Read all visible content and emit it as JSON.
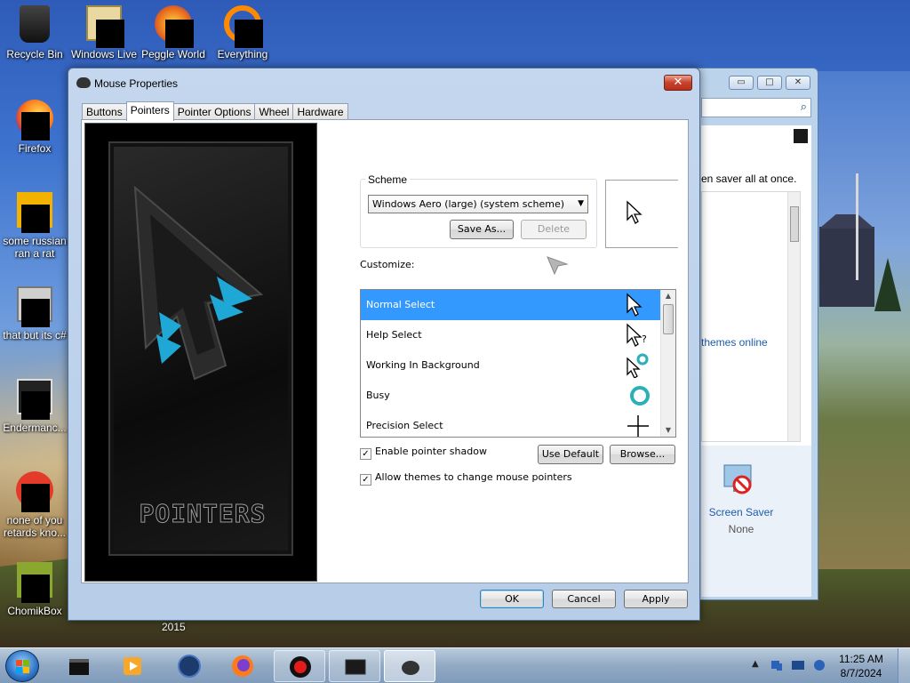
{
  "desktop": {
    "icons": [
      {
        "label": "Recycle Bin",
        "icon": "recycle-bin-icon"
      },
      {
        "label": "Windows Live",
        "icon": "windows-live-icon"
      },
      {
        "label": "Peggle World",
        "icon": "peggle-icon"
      },
      {
        "label": "Everything",
        "icon": "everything-icon"
      },
      {
        "label": "Firefox",
        "icon": "firefox-icon"
      },
      {
        "label": "some russian ran a rat",
        "icon": "shortcut-icon"
      },
      {
        "label": "that but its c#",
        "icon": "shortcut-icon"
      },
      {
        "label": "Endermanc...",
        "icon": "shortcut-icon"
      },
      {
        "label": "none of you retards kno...",
        "icon": "shortcut-icon"
      },
      {
        "label": "ChomikBox",
        "icon": "chomikbox-icon"
      }
    ],
    "year_label": "2015"
  },
  "background_window": {
    "controls": {
      "minimize": "▭",
      "maximize": "□",
      "close": "✕"
    },
    "screen_saver_text": "en saver all at once.",
    "themes_link": "themes online",
    "screen_saver_label": "Screen Saver",
    "screen_saver_value": "None"
  },
  "dialog": {
    "title": "Mouse Properties",
    "close": "✕",
    "tabs": [
      "Buttons",
      "Pointers",
      "Pointer Options",
      "Wheel",
      "Hardware"
    ],
    "active_tab": "Pointers",
    "art_wordmark": "POINTERS",
    "scheme": {
      "legend": "Scheme",
      "selected": "Windows Aero (large) (system scheme)",
      "save_as": "Save As...",
      "delete": "Delete"
    },
    "customize_label": "Customize:",
    "cursors": [
      {
        "name": "Normal Select",
        "icon": "arrow-cursor-icon",
        "selected": true
      },
      {
        "name": "Help Select",
        "icon": "help-cursor-icon",
        "selected": false
      },
      {
        "name": "Working In Background",
        "icon": "working-cursor-icon",
        "selected": false
      },
      {
        "name": "Busy",
        "icon": "busy-cursor-icon",
        "selected": false
      },
      {
        "name": "Precision Select",
        "icon": "crosshair-cursor-icon",
        "selected": false
      }
    ],
    "enable_shadow": {
      "label": "Enable pointer shadow",
      "checked": true
    },
    "allow_themes": {
      "label": "Allow themes to change mouse pointers",
      "checked": true
    },
    "use_default": "Use Default",
    "browse": "Browse...",
    "ok": "OK",
    "cancel": "Cancel",
    "apply": "Apply"
  },
  "taskbar": {
    "items": [
      {
        "name": "explorer-icon"
      },
      {
        "name": "media-player-icon"
      },
      {
        "name": "globe-icon"
      },
      {
        "name": "firefox-icon"
      },
      {
        "name": "record-icon"
      },
      {
        "name": "monitor-icon"
      },
      {
        "name": "mouse-icon"
      }
    ],
    "clock_time": "11:25 AM",
    "clock_date": "8/7/2024"
  }
}
